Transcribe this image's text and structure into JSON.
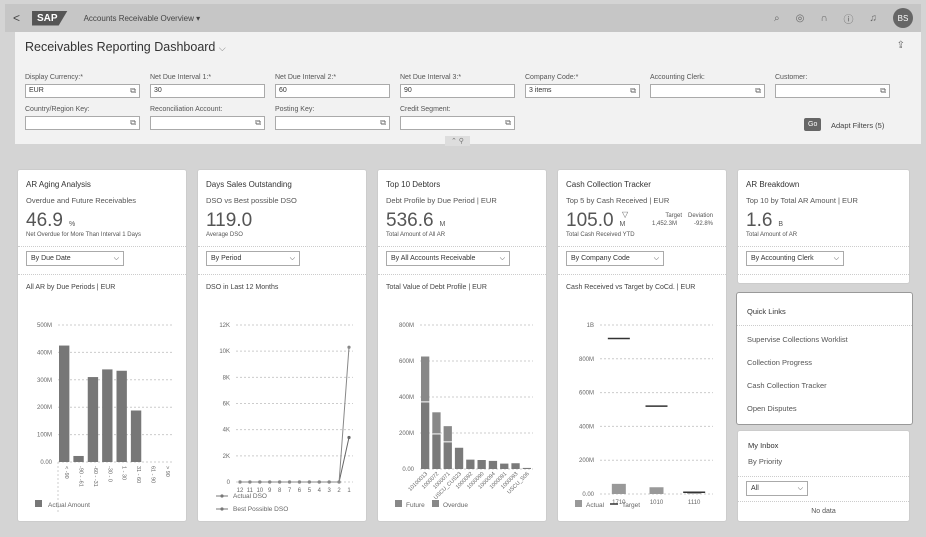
{
  "shell": {
    "back_icon": "chevron-left-icon",
    "logo": "SAP",
    "app_title": "Accounts Receivable Overview ▾",
    "avatar": "BS",
    "icons": [
      "search-icon",
      "settings-icon",
      "headset-icon",
      "help-icon",
      "bell-icon"
    ]
  },
  "header": {
    "title": "Receivables Reporting Dashboard",
    "title_chevron": "⌵",
    "share_icon": "share-icon",
    "filters": [
      {
        "label": "Display Currency:*",
        "value": "EUR",
        "vh": true
      },
      {
        "label": "Net Due Interval 1:*",
        "value": "30",
        "vh": false
      },
      {
        "label": "Net Due Interval 2:*",
        "value": "60",
        "vh": false
      },
      {
        "label": "Net Due Interval 3:*",
        "value": "90",
        "vh": false
      },
      {
        "label": "Company Code:*",
        "value": "3 items",
        "vh": true
      },
      {
        "label": "Accounting Clerk:",
        "value": "",
        "vh": true
      },
      {
        "label": "Customer:",
        "value": "",
        "vh": true
      },
      {
        "label": "Country/Region Key:",
        "value": "",
        "vh": true
      },
      {
        "label": "Reconciliation Account:",
        "value": "",
        "vh": true
      },
      {
        "label": "Posting Key:",
        "value": "",
        "vh": true
      },
      {
        "label": "Credit Segment:",
        "value": "",
        "vh": true
      }
    ],
    "go": "Go",
    "adapt": "Adapt Filters (5)",
    "collapse": "⌃  ⚲"
  },
  "cards": [
    {
      "title": "AR Aging Analysis",
      "subtitle": "Overdue and Future Receivables",
      "kpi": "46.9",
      "unit": "%",
      "kpi_label": "Net Overdue for More Than Interval 1 Days",
      "dropdown": "By Due Date",
      "chart_title": "All AR by Due Periods | EUR"
    },
    {
      "title": "Days Sales Outstanding",
      "subtitle": "DSO vs Best possible DSO",
      "kpi": "119.0",
      "unit": "",
      "kpi_label": "Average DSO",
      "dropdown": "By Period",
      "chart_title": "DSO in Last 12 Months"
    },
    {
      "title": "Top 10 Debtors",
      "subtitle": "Debt Profile by Due Period | EUR",
      "kpi": "536.6",
      "unit": "M",
      "kpi_label": "Total Amount of All AR",
      "dropdown": "By All Accounts Receivable",
      "chart_title": "Total Value of Debt Profile | EUR"
    },
    {
      "title": "Cash Collection Tracker",
      "subtitle": "Top 5 by Cash Received | EUR",
      "kpi": "105.0",
      "unit": "M",
      "kpi_label": "Total Cash Received YTD",
      "dropdown": "By Company Code",
      "chart_title": "Cash Received vs Target by CoCd. | EUR",
      "target_label": "Target",
      "target_value": "1,452.3M",
      "deviation_label": "Deviation",
      "deviation_value": "-92.8%",
      "trend_icon": "▽"
    },
    {
      "title": "AR Breakdown",
      "subtitle": "Top 10 by Total AR Amount | EUR",
      "kpi": "1.6",
      "unit": "B",
      "kpi_label": "Total Amount of AR",
      "dropdown": "By Accounting Clerk"
    }
  ],
  "quick_links": {
    "title": "Quick Links",
    "items": [
      "Supervise Collections Worklist",
      "Collection Progress",
      "Cash Collection Tracker",
      "Open Disputes"
    ]
  },
  "inbox": {
    "title": "My Inbox",
    "subtitle": "By Priority",
    "dropdown": "All",
    "empty": "No data"
  },
  "chart_data": [
    {
      "type": "bar",
      "title": "All AR by Due Periods | EUR",
      "categories": [
        "< -90",
        "-90 - -61",
        "-60 - -31",
        "-30 - 0",
        "1 - 30",
        "31 - 60",
        "61 - 90",
        "> 90"
      ],
      "series": [
        {
          "name": "Actual Amount",
          "values": [
            425,
            22,
            310,
            338,
            333,
            188,
            0,
            0
          ]
        }
      ],
      "unit": "M",
      "ylim": [
        0,
        500
      ],
      "yticks": [
        "0.00",
        "100M",
        "200M",
        "300M",
        "400M",
        "500M"
      ],
      "grid": true,
      "legend": "bottom"
    },
    {
      "type": "line",
      "title": "DSO in Last 12 Months",
      "categories": [
        "12",
        "11",
        "10",
        "9",
        "8",
        "7",
        "6",
        "5",
        "4",
        "3",
        "2",
        "1"
      ],
      "series": [
        {
          "name": "Actual DSO",
          "values": [
            0,
            0,
            0,
            0,
            0,
            0,
            0,
            0,
            0,
            0,
            0,
            3400
          ]
        },
        {
          "name": "Best Possible DSO",
          "values": [
            0,
            0,
            0,
            0,
            0,
            0,
            0,
            0,
            0,
            0,
            0,
            10300
          ]
        }
      ],
      "ylim": [
        0,
        12000
      ],
      "yticks": [
        "0",
        "2K",
        "4K",
        "6K",
        "8K",
        "10K",
        "12K"
      ],
      "grid": true,
      "legend": "bottom"
    },
    {
      "type": "bar",
      "stacked": true,
      "title": "Total Value of Debt Profile | EUR",
      "categories": [
        "10100013",
        "1000072",
        "1000071",
        "USCU_CUS23",
        "1000092",
        "1000090",
        "1000094",
        "1000091",
        "1000093",
        "USCU_S06"
      ],
      "series": [
        {
          "name": "Overdue",
          "values": [
            370,
            192,
            148,
            118,
            52,
            50,
            45,
            30,
            32,
            6
          ]
        },
        {
          "name": "Future",
          "values": [
            255,
            123,
            90,
            0,
            0,
            0,
            0,
            0,
            0,
            0
          ]
        }
      ],
      "legend_order": [
        "Future",
        "Overdue"
      ],
      "unit": "M",
      "ylim": [
        0,
        800
      ],
      "yticks": [
        "0.00",
        "200M",
        "400M",
        "600M",
        "800M"
      ],
      "grid": true,
      "legend": "bottom"
    },
    {
      "type": "bar",
      "title": "Cash Received vs Target by CoCd. | EUR",
      "categories": [
        "1710",
        "1010",
        "1110"
      ],
      "series": [
        {
          "name": "Actual",
          "values": [
            60,
            40,
            5
          ]
        },
        {
          "name": "Target",
          "values": [
            920,
            520,
            10
          ]
        }
      ],
      "unit": "M",
      "ylim": [
        0,
        1000
      ],
      "yticks": [
        "0.00",
        "200M",
        "400M",
        "600M",
        "800M",
        "1B"
      ],
      "grid": true,
      "legend": "bottom"
    }
  ]
}
